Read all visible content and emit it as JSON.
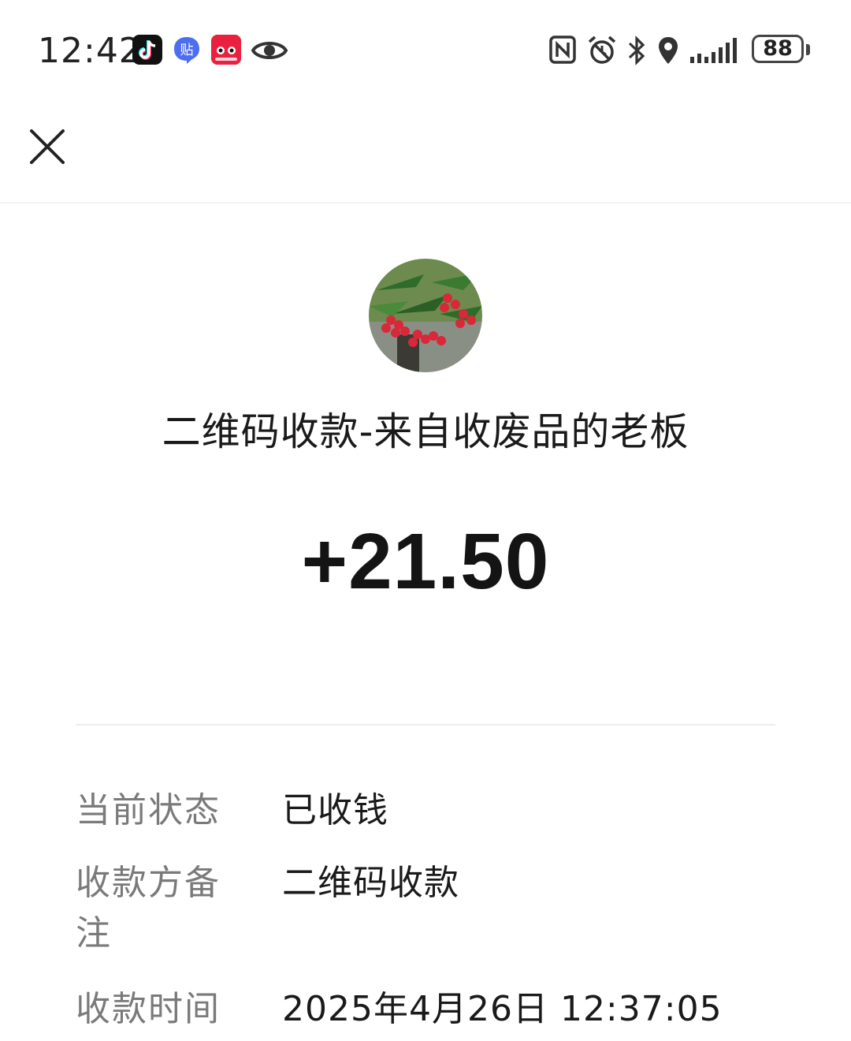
{
  "status_bar": {
    "time": "12:42",
    "tieba_glyph": "贴",
    "battery_level": "88",
    "app_icons": [
      "tiktok-icon",
      "tieba-icon",
      "tmall-icon",
      "eye-icon"
    ],
    "system_icons": [
      "nfc-icon",
      "alarm-icon",
      "bluetooth-icon",
      "location-icon",
      "signal-icon",
      "battery-icon"
    ]
  },
  "nav": {
    "close_icon": "close-icon"
  },
  "header": {
    "avatar": "avatar-red-berries-photo",
    "title": "二维码收款-来自收废品的老板",
    "amount": "+21.50"
  },
  "details": [
    {
      "label": "当前状态",
      "value": "已收钱"
    },
    {
      "label": "收款方备注",
      "value": "二维码收款"
    },
    {
      "label": "收款时间",
      "value": "2025年4月26日 12:37:05"
    }
  ],
  "colors": {
    "background": "#ffffff",
    "label_text": "#7a7a7a",
    "value_text": "#1a1a1a",
    "divider": "#ededed"
  }
}
